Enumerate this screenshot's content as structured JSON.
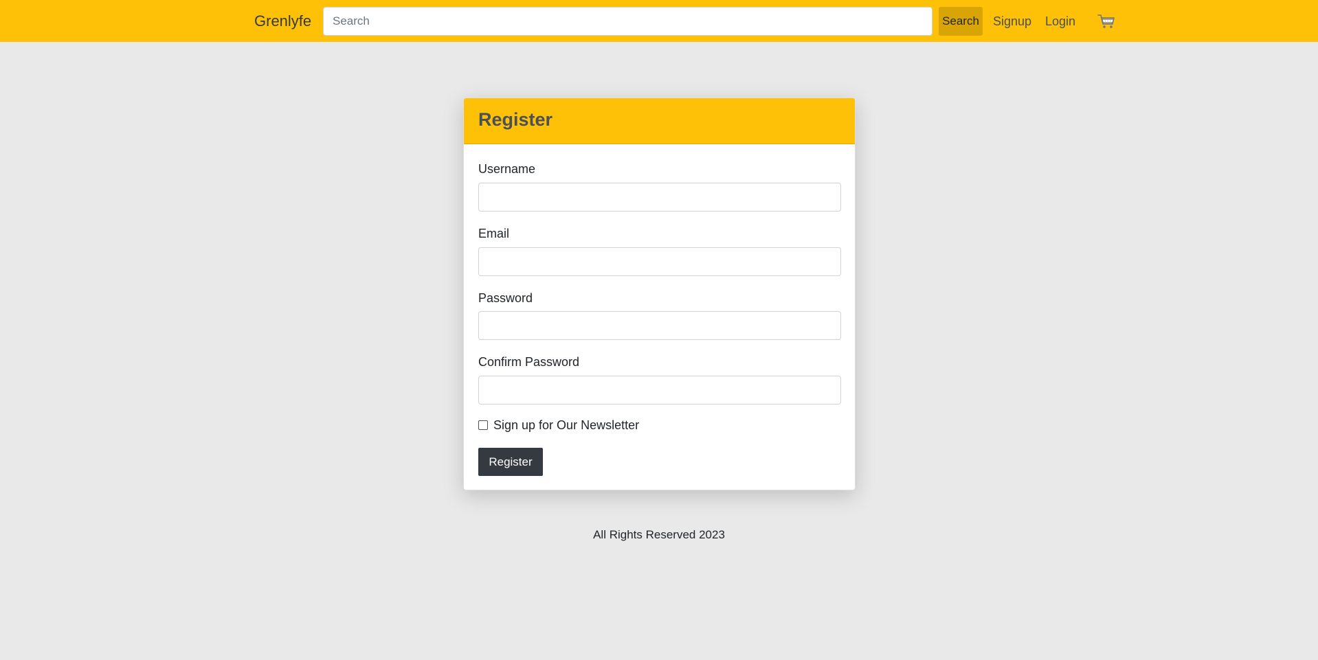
{
  "navbar": {
    "brand": "Grenlyfe",
    "search_placeholder": "Search",
    "search_button": "Search",
    "links": [
      "Signup",
      "Login"
    ],
    "cart_icon": "cart-icon"
  },
  "register_card": {
    "title": "Register",
    "fields": [
      {
        "label": "Username",
        "value": ""
      },
      {
        "label": "Email",
        "value": ""
      },
      {
        "label": "Password",
        "value": ""
      },
      {
        "label": "Confirm Password",
        "value": ""
      }
    ],
    "newsletter_label": "Sign up for Our Newsletter",
    "newsletter_checked": false,
    "submit_label": "Register"
  },
  "footer": {
    "text": "All Rights Reserved 2023"
  },
  "colors": {
    "accent": "#ffc107",
    "background": "#e9e9e9",
    "button_dark": "#343a40"
  }
}
